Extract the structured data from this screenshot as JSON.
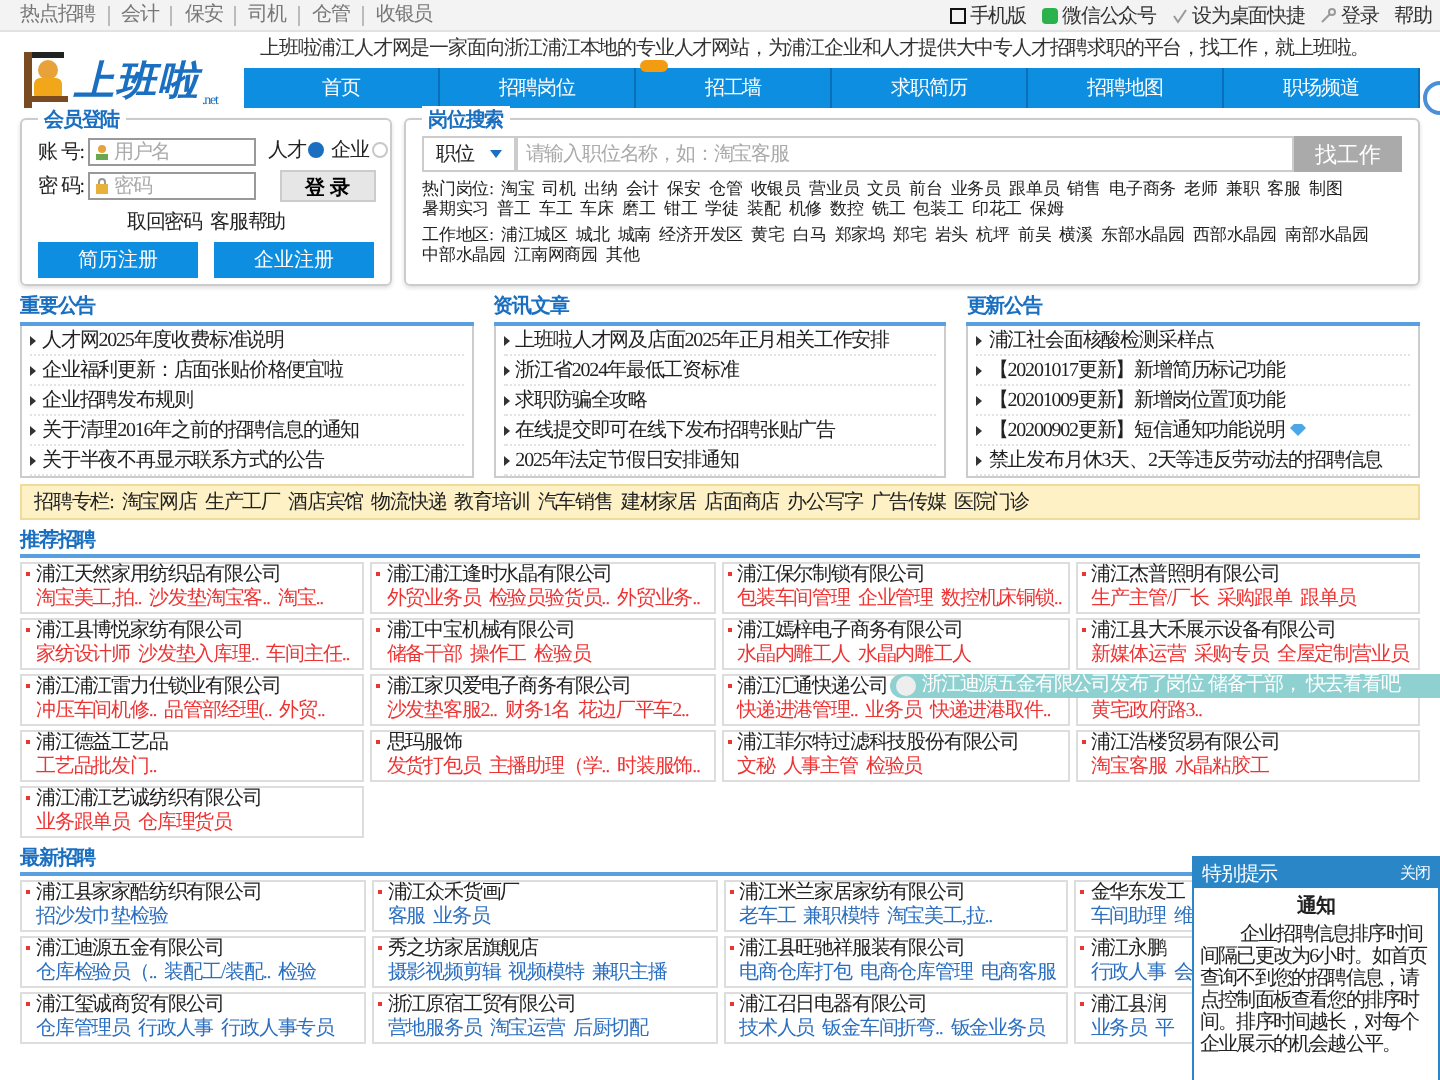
{
  "top_bar": {
    "hot_links": [
      "热点招聘",
      "会计",
      "保安",
      "司机",
      "仓管",
      "收银员"
    ],
    "tools": [
      {
        "kind": "mobile",
        "label": "手机版"
      },
      {
        "kind": "wechat",
        "label": "微信公众号"
      },
      {
        "kind": "shortcut",
        "label": "设为桌面快捷"
      },
      {
        "kind": "login",
        "label": "登录"
      },
      {
        "kind": "help",
        "label": "帮助"
      }
    ]
  },
  "logo": {
    "text": "上班啦",
    "suffix": ".net"
  },
  "intro": "上班啦浦江人才网是一家面向浙江浦江本地的专业人才网站，为浦江企业和人才提供大中专人才招聘求职的平台，找工作，就上班啦。",
  "nav": [
    {
      "label": "首页",
      "badge": false
    },
    {
      "label": "招聘岗位",
      "badge": false
    },
    {
      "label": "招工墙",
      "badge": true
    },
    {
      "label": "求职简历",
      "badge": false
    },
    {
      "label": "招聘地图",
      "badge": false
    },
    {
      "label": "职场频道",
      "badge": false
    }
  ],
  "login": {
    "title": "会员登陆",
    "account_label": "账 号:",
    "account_placeholder": "用户名",
    "password_label": "密 码:",
    "password_placeholder": "密码",
    "roles": [
      {
        "label": "人才",
        "selected": true
      },
      {
        "label": "企业",
        "selected": false
      }
    ],
    "submit": "登 录",
    "links": [
      "取回密码",
      "客服帮助"
    ],
    "register": [
      "简历注册",
      "企业注册"
    ]
  },
  "search": {
    "title": "岗位搜索",
    "category": "职位",
    "placeholder": "请输入职位名称，如：淘宝客服",
    "button": "找工作",
    "hot_label": "热门岗位:",
    "hot": [
      "淘宝",
      "司机",
      "出纳",
      "会计",
      "保安",
      "仓管",
      "收银员",
      "营业员",
      "文员",
      "前台",
      "业务员",
      "跟单员",
      "销售",
      "电子商务",
      "老师",
      "兼职",
      "客服",
      "制图",
      "暑期实习",
      "普工",
      "车工",
      "车床",
      "磨工",
      "钳工",
      "学徒",
      "装配",
      "机修",
      "数控",
      "铣工",
      "包装工",
      "印花工",
      "保姆"
    ],
    "area_label": "工作地区:",
    "areas": [
      "浦江城区",
      "城北",
      "城南",
      "经济开发区",
      "黄宅",
      "白马",
      "郑家坞",
      "郑宅",
      "岩头",
      "杭坪",
      "前吴",
      "横溪",
      "东部水晶园",
      "西部水晶园",
      "南部水晶园",
      "中部水晶园",
      "江南网商园",
      "其他"
    ]
  },
  "notices": [
    {
      "title": "重要公告",
      "items": [
        {
          "text": "人才网2025年度收费标准说明",
          "diamond": false
        },
        {
          "text": "企业福利更新：店面张贴价格便宜啦",
          "diamond": false
        },
        {
          "text": "企业招聘发布规则",
          "diamond": false
        },
        {
          "text": "关于清理2016年之前的招聘信息的通知",
          "diamond": false
        },
        {
          "text": "关于半夜不再显示联系方式的公告",
          "diamond": false
        }
      ]
    },
    {
      "title": "资讯文章",
      "items": [
        {
          "text": "上班啦人才网及店面2025年正月相关工作安排",
          "diamond": false
        },
        {
          "text": "浙江省2024年最低工资标准",
          "diamond": false
        },
        {
          "text": "求职防骗全攻略",
          "diamond": false
        },
        {
          "text": "在线提交即可在线下发布招聘张贴广告",
          "diamond": false
        },
        {
          "text": "2025年法定节假日安排通知",
          "diamond": false
        }
      ]
    },
    {
      "title": "更新公告",
      "items": [
        {
          "text": "浦江社会面核酸检测采样点",
          "diamond": false
        },
        {
          "text": "【20201017更新】新增简历标记功能",
          "diamond": false
        },
        {
          "text": "【20201009更新】新增岗位置顶功能",
          "diamond": false
        },
        {
          "text": "【20200902更新】短信通知功能说明",
          "diamond": true
        },
        {
          "text": "禁止发布月休3天、2天等违反劳动法的招聘信息",
          "diamond": false
        }
      ]
    }
  ],
  "columns_banner": {
    "label": "招聘专栏:",
    "links": [
      "淘宝网店",
      "生产工厂",
      "酒店宾馆",
      "物流快递",
      "教育培训",
      "汽车销售",
      "建材家居",
      "店面商店",
      "办公写字",
      "广告传媒",
      "医院门诊"
    ]
  },
  "recommended": {
    "title": "推荐招聘",
    "jobs": [
      {
        "company": "浦江天然家用纺织品有限公司",
        "positions": [
          "淘宝美工,拍..",
          "沙发垫淘宝客..",
          "淘宝.."
        ]
      },
      {
        "company": "浦江浦江逢时水晶有限公司",
        "positions": [
          "外贸业务员",
          "检验员验货员..",
          "外贸业务.."
        ]
      },
      {
        "company": "浦江保尔制锁有限公司",
        "positions": [
          "包装车间管理",
          "企业管理",
          "数控机床铜锁.."
        ]
      },
      {
        "company": "浦江杰普照明有限公司",
        "positions": [
          "生产主管/厂长",
          "采购跟单",
          "跟单员"
        ]
      },
      {
        "company": "浦江县博悦家纺有限公司",
        "positions": [
          "家纺设计师",
          "沙发垫入库理..",
          "车间主任.."
        ]
      },
      {
        "company": "浦江中宝机械有限公司",
        "positions": [
          "储备干部",
          "操作工",
          "检验员"
        ]
      },
      {
        "company": "浦江嫣梓电子商务有限公司",
        "positions": [
          "水晶内雕工人",
          "水晶内雕工人"
        ]
      },
      {
        "company": "浦江县大禾展示设备有限公司",
        "positions": [
          "新媒体运营",
          "采购专员",
          "全屋定制营业员"
        ]
      },
      {
        "company": "浦江浦江雷力仕锁业有限公司",
        "positions": [
          "冲压车间机修..",
          "品管部经理(..",
          "外贸.."
        ]
      },
      {
        "company": "浦江家贝爱电子商务有限公司",
        "positions": [
          "沙发垫客服2..",
          "财务1名",
          "花边厂平车2.."
        ]
      },
      {
        "company": "浦江汇通快递公司",
        "positions": [
          "快递进港管理..",
          "业务员",
          "快递进港取件.."
        ]
      },
      {
        "positions": [
          "黄宅政府路3.."
        ]
      },
      {
        "company": "浦江德益工艺品",
        "positions": [
          "工艺品批发门.."
        ]
      },
      {
        "company": "思玛服饰",
        "positions": [
          "发货打包员",
          "主播助理（学..",
          "时装服饰.."
        ]
      },
      {
        "company": "浦江菲尔特过滤科技股份有限公司",
        "positions": [
          "文秘",
          "人事主管",
          "检验员"
        ]
      },
      {
        "company": "浦江浩楼贸易有限公司",
        "positions": [
          "淘宝客服",
          "水晶粘胶工"
        ]
      },
      {
        "company": "浦江浦江艺诚纺织有限公司",
        "positions": [
          "业务跟单员",
          "仓库理货员"
        ]
      }
    ]
  },
  "toast": {
    "text": "浙江迪源五金有限公司发布了岗位 储备干部， 快去看看吧"
  },
  "latest": {
    "title": "最新招聘",
    "jobs": [
      {
        "company": "浦江县家家酷纺织有限公司",
        "positions": [
          "招沙发巾垫检验"
        ]
      },
      {
        "company": "浦江众禾货画厂",
        "positions": [
          "客服",
          "业务员"
        ]
      },
      {
        "company": "浦江米兰家居家纺有限公司",
        "positions": [
          "老车工",
          "兼职模特",
          "淘宝美工,拉.."
        ]
      },
      {
        "company": "金华东发工",
        "positions": [
          "车间助理",
          "维"
        ]
      },
      {
        "company": "浦江迪源五金有限公司",
        "positions": [
          "仓库检验员（..",
          "装配工/装配..",
          "检验"
        ]
      },
      {
        "company": "秀之坊家居旗舰店",
        "positions": [
          "摄影视频剪辑",
          "视频模特",
          "兼职主播"
        ]
      },
      {
        "company": "浦江县旺驰祥服装有限公司",
        "positions": [
          "电商仓库打包",
          "电商仓库管理",
          "电商客服"
        ]
      },
      {
        "company": "浦江永鹏",
        "positions": [
          "行政人事",
          "会"
        ]
      },
      {
        "company": "浦江玺诚商贸有限公司",
        "positions": [
          "仓库管理员",
          "行政人事",
          "行政人事专员"
        ]
      },
      {
        "company": "浙江原宿工贸有限公司",
        "positions": [
          "营地服务员",
          "淘宝运营",
          "后厨切配"
        ]
      },
      {
        "company": "浦江召日电器有限公司",
        "positions": [
          "技术人员",
          "钣金车间折弯..",
          "钣金业务员"
        ]
      },
      {
        "company": "浦江县润",
        "positions": [
          "业务员",
          "平"
        ]
      }
    ]
  },
  "popup": {
    "header": "特别提示",
    "close": "关闭",
    "title": "通知",
    "body": "企业招聘信息排序时间间隔已更改为6小时。如首页查询不到您的招聘信息，请点控制面板查看您的排序时间。排序时间越长，对每个企业展示的机会越公平。"
  }
}
